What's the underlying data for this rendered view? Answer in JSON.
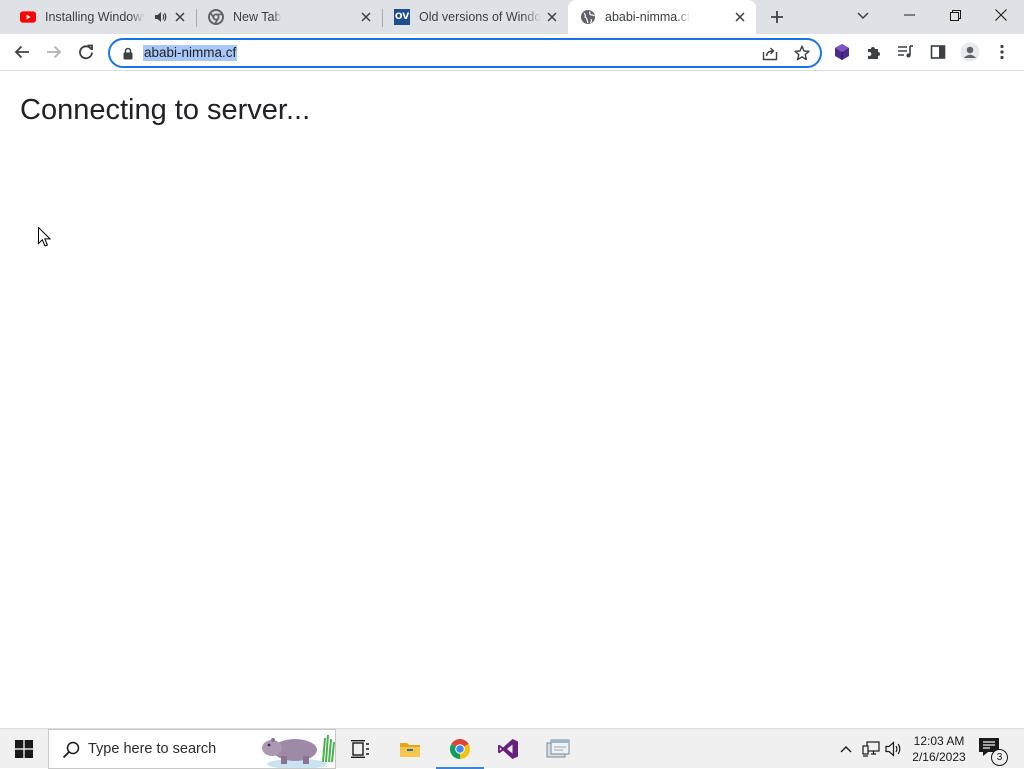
{
  "browser": {
    "tabs": [
      {
        "title": "Installing Windows",
        "icon": "youtube-icon"
      },
      {
        "title": "New Tab",
        "icon": "chrome-icon"
      },
      {
        "title": "Old versions of Windo",
        "icon": "ov-icon",
        "icon_text": "OV"
      },
      {
        "title": "ababi-nimma.cf",
        "icon": "globe-icon",
        "active": true
      }
    ],
    "address_bar": {
      "url": "ababi-nimma.cf"
    }
  },
  "page": {
    "heading": "Connecting to server..."
  },
  "taskbar": {
    "search_placeholder": "Type here to search",
    "clock": {
      "time": "12:03 AM",
      "date": "2/16/2023"
    },
    "notification_count": "3",
    "pinned_apps": [
      "task-view",
      "file-explorer",
      "chrome",
      "visual-studio",
      "app"
    ]
  },
  "colors": {
    "accent": "#1a73e8",
    "tab_strip": "#dee1e6",
    "url_selection": "#a8c7fa",
    "youtube_red": "#ff0000",
    "ov_blue": "#1f4e8c",
    "taskbar_bg": "#f0f0f0"
  }
}
